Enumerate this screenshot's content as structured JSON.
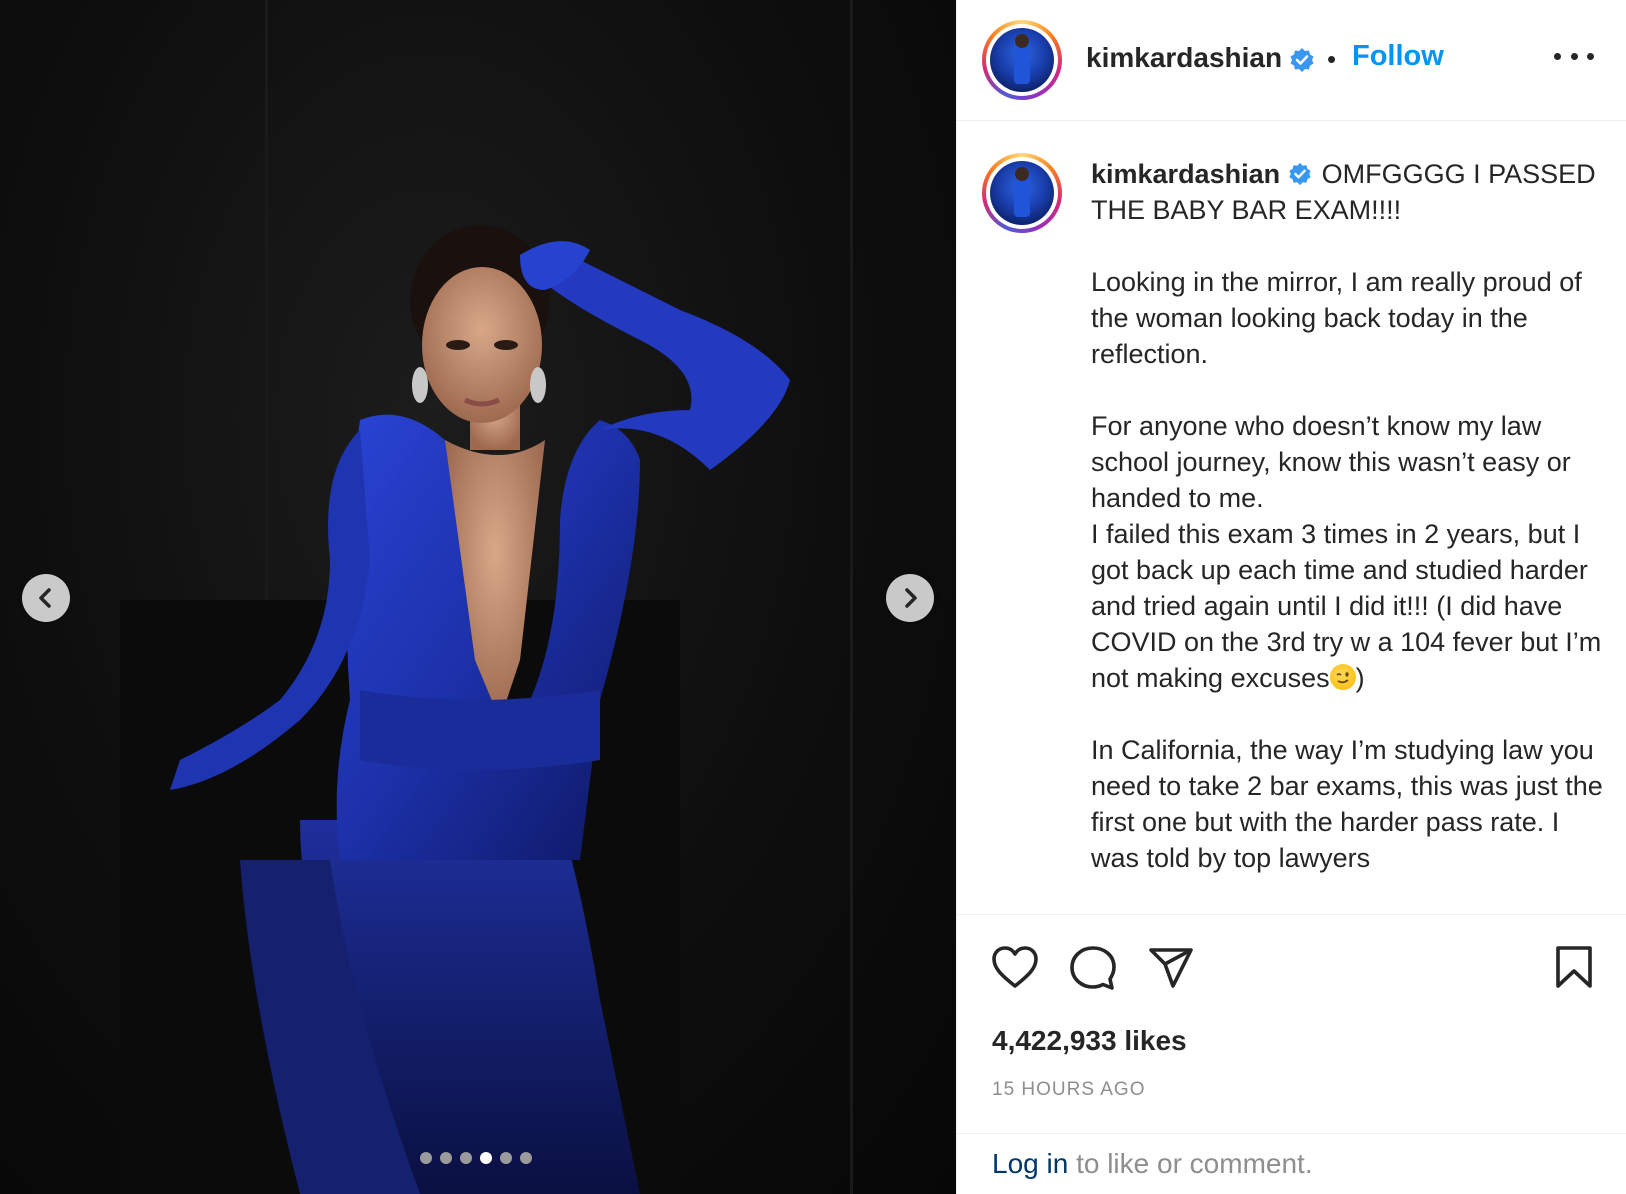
{
  "post": {
    "username": "kimkardashian",
    "follow_label": "Follow",
    "bullet": "•",
    "caption_prefix": " OMFGGGG I PASSED THE BABY BAR EXAM!!!!",
    "caption_body": "\n\nLooking in the mirror, I am really proud of the woman looking back today in the reflection.\n\nFor anyone who doesn’t know my law school journey, know this wasn’t easy or handed to me.\nI failed this exam 3 times in 2 years, but I got back up each time and studied harder and tried again until I did it!!! (I did have COVID on the 3rd try w a 104 fever but I’m not making excuses",
    "caption_after_emoji": ")\n\nIn California, the way I’m studying law you need to take 2 bar exams, this was just the first one but with the harder pass rate. I was told by top lawyers",
    "likes": "4,422,933 likes",
    "time": "15 HOURS AGO",
    "login_link": "Log in",
    "login_rest": " to like or comment."
  },
  "carousel": {
    "count": 6,
    "active_index": 3
  },
  "icons": {
    "verified": "verified-badge-icon",
    "like": "heart-icon",
    "comment": "comment-icon",
    "share": "paper-plane-icon",
    "save": "bookmark-icon",
    "prev": "chevron-left-icon",
    "next": "chevron-right-icon",
    "more": "more-horizontal-icon",
    "wink_emoji": "winking-face-emoji"
  },
  "colors": {
    "accent": "#0095f6",
    "link_dark": "#00376b",
    "dress_blue": "#1f35b8",
    "muted": "#8e8e8e"
  }
}
